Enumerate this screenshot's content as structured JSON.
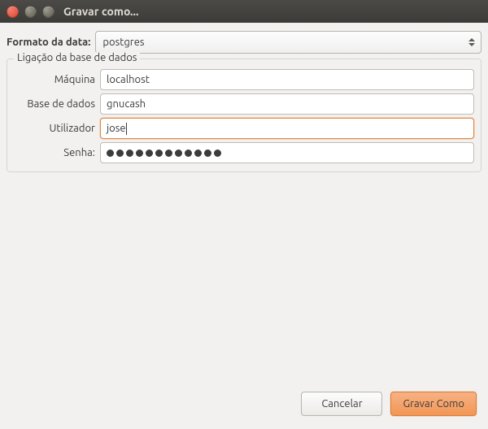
{
  "window": {
    "title": "Gravar como..."
  },
  "format": {
    "label": "Formato da data:",
    "value": "postgres"
  },
  "connection": {
    "legend": "Ligação da base de dados",
    "host_label": "Máquina",
    "host_value": "localhost",
    "db_label": "Base de dados",
    "db_value": "gnucash",
    "user_label": "Utilizador",
    "user_value": "jose",
    "password_label": "Senha:",
    "password_length": 12
  },
  "buttons": {
    "cancel": "Cancelar",
    "save_as": "Gravar Como"
  }
}
